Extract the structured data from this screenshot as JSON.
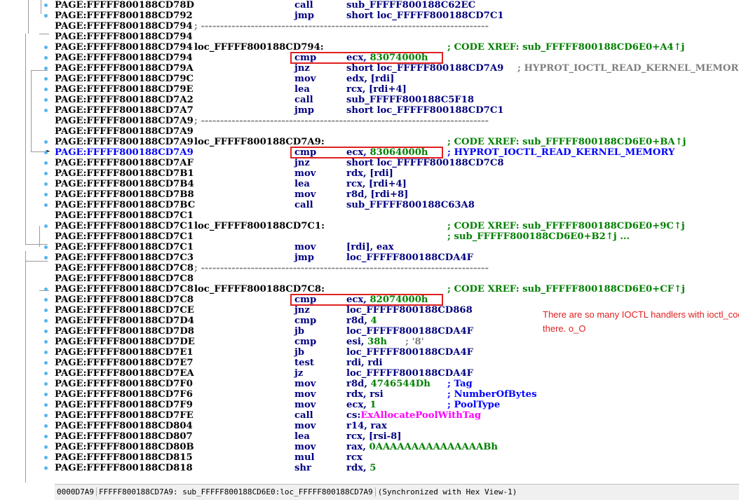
{
  "rows": [
    {
      "addr": "PAGE:FFFFF800188CD78D",
      "mnem": "call",
      "ops": "sub_FFFFF800188C62EC"
    },
    {
      "addr": "PAGE:FFFFF800188CD792",
      "mnem": "jmp",
      "ops": "short loc_FFFFF800188CD7C1"
    },
    {
      "addr": "PAGE:FFFFF800188CD794",
      "sep": "; ---------------------------------------------------------------------------"
    },
    {
      "addr": "PAGE:FFFFF800188CD794"
    },
    {
      "addr": "PAGE:FFFFF800188CD794",
      "label": "loc_FFFFF800188CD794:",
      "comment": "; CODE XREF: sub_FFFFF800188CD6E0+A4↑j"
    },
    {
      "addr": "PAGE:FFFFF800188CD794",
      "mnem": "cmp",
      "ops": "ecx, ",
      "num": "83074000h"
    },
    {
      "addr": "PAGE:FFFFF800188CD79A",
      "mnem": "jnz",
      "ops": "short loc_FFFFF800188CD7A9",
      "graycomment": "; HYPROT_IOCTL_READ_KERNEL_MEMORY"
    },
    {
      "addr": "PAGE:FFFFF800188CD79C",
      "mnem": "mov",
      "ops": "edx, [rdi]"
    },
    {
      "addr": "PAGE:FFFFF800188CD79E",
      "mnem": "lea",
      "ops": "rcx, [rdi+4]"
    },
    {
      "addr": "PAGE:FFFFF800188CD7A2",
      "mnem": "call",
      "ops": "sub_FFFFF800188C5F18"
    },
    {
      "addr": "PAGE:FFFFF800188CD7A7",
      "mnem": "jmp",
      "ops": "short loc_FFFFF800188CD7C1"
    },
    {
      "addr": "PAGE:FFFFF800188CD7A9",
      "sep": "; ---------------------------------------------------------------------------"
    },
    {
      "addr": "PAGE:FFFFF800188CD7A9"
    },
    {
      "addr": "PAGE:FFFFF800188CD7A9",
      "label": "loc_FFFFF800188CD7A9:",
      "comment": "; CODE XREF: sub_FFFFF800188CD6E0+BA↑j"
    },
    {
      "addr": "PAGE:FFFFF800188CD7A9",
      "mnem": "cmp",
      "ops": "ecx, ",
      "num": "83064000h",
      "bluecomment": "; HYPROT_IOCTL_READ_KERNEL_MEMORY",
      "highlight": true
    },
    {
      "addr": "PAGE:FFFFF800188CD7AF",
      "mnem": "jnz",
      "ops": "short loc_FFFFF800188CD7C8"
    },
    {
      "addr": "PAGE:FFFFF800188CD7B1",
      "mnem": "mov",
      "ops": "rdx, [rdi]"
    },
    {
      "addr": "PAGE:FFFFF800188CD7B4",
      "mnem": "lea",
      "ops": "rcx, [rdi+4]"
    },
    {
      "addr": "PAGE:FFFFF800188CD7B8",
      "mnem": "mov",
      "ops": "r8d, [rdi+8]"
    },
    {
      "addr": "PAGE:FFFFF800188CD7BC",
      "mnem": "call",
      "ops": "sub_FFFFF800188C63A8"
    },
    {
      "addr": "PAGE:FFFFF800188CD7C1"
    },
    {
      "addr": "PAGE:FFFFF800188CD7C1",
      "label": "loc_FFFFF800188CD7C1:",
      "comment": "; CODE XREF: sub_FFFFF800188CD6E0+9C↑j"
    },
    {
      "addr": "PAGE:FFFFF800188CD7C1",
      "comment": "; sub_FFFFF800188CD6E0+B2↑j ..."
    },
    {
      "addr": "PAGE:FFFFF800188CD7C1",
      "mnem": "mov",
      "ops": "[rdi], eax"
    },
    {
      "addr": "PAGE:FFFFF800188CD7C3",
      "mnem": "jmp",
      "ops": "loc_FFFFF800188CDA4F"
    },
    {
      "addr": "PAGE:FFFFF800188CD7C8",
      "sep": "; ---------------------------------------------------------------------------"
    },
    {
      "addr": "PAGE:FFFFF800188CD7C8"
    },
    {
      "addr": "PAGE:FFFFF800188CD7C8",
      "label": "loc_FFFFF800188CD7C8:",
      "comment": "; CODE XREF: sub_FFFFF800188CD6E0+CF↑j"
    },
    {
      "addr": "PAGE:FFFFF800188CD7C8",
      "mnem": "cmp",
      "ops": "ecx, ",
      "num": "82074000h"
    },
    {
      "addr": "PAGE:FFFFF800188CD7CE",
      "mnem": "jnz",
      "ops": "loc_FFFFF800188CD868"
    },
    {
      "addr": "PAGE:FFFFF800188CD7D4",
      "mnem": "cmp",
      "ops": "r8d, ",
      "num": "4"
    },
    {
      "addr": "PAGE:FFFFF800188CD7D8",
      "mnem": "jb",
      "ops": "loc_FFFFF800188CDA4F"
    },
    {
      "addr": "PAGE:FFFFF800188CD7DE",
      "mnem": "cmp",
      "ops": "esi, ",
      "num": "38h",
      "graycomment": "; '8'"
    },
    {
      "addr": "PAGE:FFFFF800188CD7E1",
      "mnem": "jb",
      "ops": "loc_FFFFF800188CDA4F"
    },
    {
      "addr": "PAGE:FFFFF800188CD7E7",
      "mnem": "test",
      "ops": "rdi, rdi"
    },
    {
      "addr": "PAGE:FFFFF800188CD7EA",
      "mnem": "jz",
      "ops": "loc_FFFFF800188CDA4F"
    },
    {
      "addr": "PAGE:FFFFF800188CD7F0",
      "mnem": "mov",
      "ops": "r8d, ",
      "num": "4746544Dh",
      "bluecomment": "; Tag"
    },
    {
      "addr": "PAGE:FFFFF800188CD7F6",
      "mnem": "mov",
      "ops": "rdx, rsi",
      "bluecomment": "; NumberOfBytes"
    },
    {
      "addr": "PAGE:FFFFF800188CD7F9",
      "mnem": "mov",
      "ops": "ecx, ",
      "num": "1",
      "bluecomment": "; PoolType"
    },
    {
      "addr": "PAGE:FFFFF800188CD7FE",
      "mnem": "call",
      "ops": "cs:",
      "imp": "ExAllocatePoolWithTag"
    },
    {
      "addr": "PAGE:FFFFF800188CD804",
      "mnem": "mov",
      "ops": "r14, rax"
    },
    {
      "addr": "PAGE:FFFFF800188CD807",
      "mnem": "lea",
      "ops": "rcx, [rsi-8]"
    },
    {
      "addr": "PAGE:FFFFF800188CD80B",
      "mnem": "mov",
      "ops": "rax, ",
      "num": "0AAAAAAAAAAAAAAABh"
    },
    {
      "addr": "PAGE:FFFFF800188CD815",
      "mnem": "mul",
      "ops": "rcx"
    },
    {
      "addr": "PAGE:FFFFF800188CD818",
      "mnem": "shr",
      "ops": "rdx, ",
      "num": "5"
    }
  ],
  "annotation": "There are so many IOCTL handlers with ioctl_code there. o_O",
  "statusbar": {
    "offset": "0000D7A9",
    "location": "FFFFF800188CD7A9: sub_FFFFF800188CD6E0:loc_FFFFF800188CD7A9",
    "sync": "(Synchronized with Hex View-1)"
  },
  "colors": {
    "address": "#000000",
    "highlight_address": "#0000ff",
    "mnemonic": "#000080",
    "number": "#008000",
    "comment": "#008000",
    "import": "#ff00ff",
    "annotation": "#e02020",
    "gutter_dot": "#5ab4e8"
  }
}
